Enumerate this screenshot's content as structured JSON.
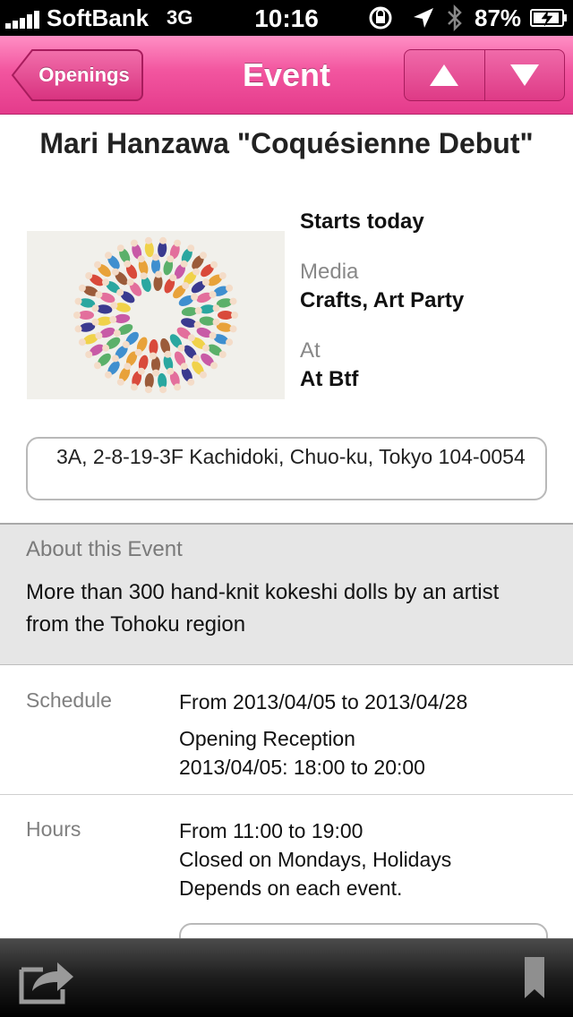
{
  "status_bar": {
    "carrier": "SoftBank",
    "network": "3G",
    "time": "10:16",
    "battery": "87%"
  },
  "nav": {
    "back_label": "Openings",
    "title": "Event",
    "prev_icon": "up-triangle-icon",
    "next_icon": "down-triangle-icon",
    "accent_color": "#ee4a97"
  },
  "event": {
    "title": "Mari Hanzawa \"Coquésienne Debut\"",
    "starts": "Starts today",
    "media_label": "Media",
    "media_value": "Crafts, Art Party",
    "at_label": "At",
    "at_value": "At Btf",
    "address": "3A, 2-8-19-3F Kachidoki, Chuo-ku, Tokyo 104-0054"
  },
  "about": {
    "title": "About this Event",
    "description": "More than 300 hand-knit kokeshi dolls by an artist from the Tohoku region"
  },
  "schedule": {
    "label": "Schedule",
    "line1": "From 2013/04/05 to 2013/04/28",
    "line2": "Opening Reception",
    "line3": "2013/04/05: 18:00 to 20:00"
  },
  "hours": {
    "label": "Hours",
    "line1": "From 11:00 to 19:00",
    "line2": "Closed on Mondays, Holidays",
    "line3": "Depends on each event."
  },
  "toolbar": {
    "share_icon": "share-icon",
    "bookmark_icon": "bookmark-icon"
  }
}
